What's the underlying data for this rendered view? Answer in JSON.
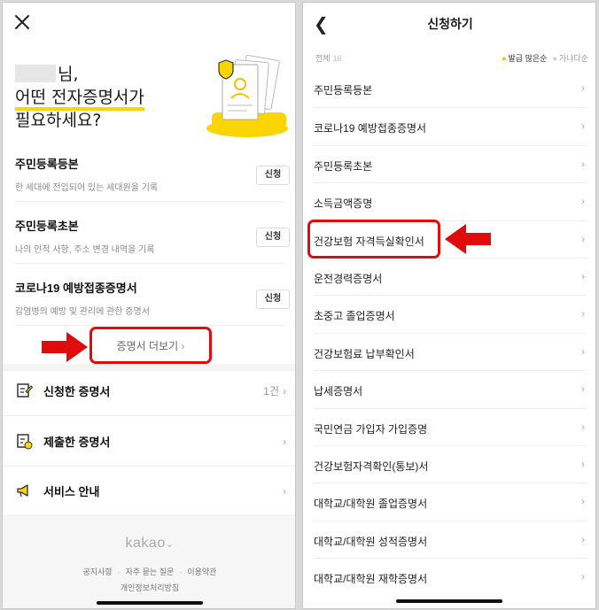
{
  "left": {
    "greeting_line1": "님,",
    "greeting_line2": "어떤 전자증명서가",
    "greeting_line3": "필요하세요?",
    "certificates": [
      {
        "title": "주민등록등본",
        "desc": "한 세대에 전입되어 있는 세대원을 기록",
        "button": "신청"
      },
      {
        "title": "주민등록초본",
        "desc": "나의 인적 사항, 주소 변경 내역을 기록",
        "button": "신청"
      },
      {
        "title": "코로나19 예방접종증명서",
        "desc": "감염병의 예방 및 관리에 관한 증명서",
        "button": "신청"
      }
    ],
    "more_label": "증명서 더보기",
    "menu": [
      {
        "label": "신청한 증명서",
        "count": "1건",
        "icon": "edit-document-icon"
      },
      {
        "label": "제출한 증명서",
        "count": "",
        "icon": "submitted-document-icon"
      },
      {
        "label": "서비스 안내",
        "count": "",
        "icon": "megaphone-icon"
      }
    ],
    "footer": {
      "brand": "kakao",
      "links": [
        "공지사항",
        "자주 묻는 질문",
        "이용약관"
      ],
      "privacy": "개인정보처리방침"
    }
  },
  "right": {
    "title": "신청하기",
    "total_label": "전체",
    "total_count": "16",
    "sort_popular": "발급 많은순",
    "sort_alpha": "가나다순",
    "items": [
      "주민등록등본",
      "코로나19 예방접종증명서",
      "주민등록초본",
      "소득금액증명",
      "건강보험 자격득실확인서",
      "운전경력증명서",
      "초중고 졸업증명서",
      "건강보험료 납부확인서",
      "납세증명서",
      "국민연금 가입자 가입증명",
      "건강보험자격확인(통보)서",
      "대학교/대학원 졸업증명서",
      "대학교/대학원 성적증명서",
      "대학교/대학원 재학증명서"
    ]
  },
  "colors": {
    "highlight_yellow": "#fbd500",
    "annotation_red": "#e00c0c"
  }
}
